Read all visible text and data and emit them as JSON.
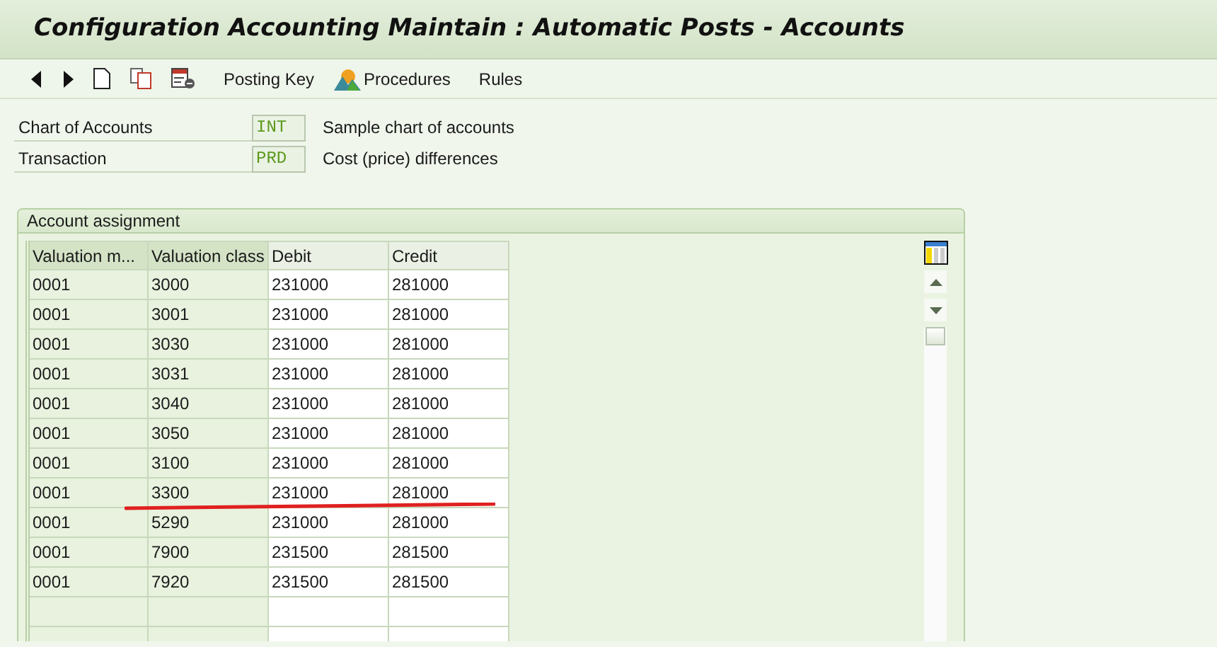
{
  "window": {
    "title": "Configuration Accounting Maintain : Automatic Posts - Accounts"
  },
  "toolbar": {
    "buttons": [
      {
        "kind": "back"
      },
      {
        "kind": "forward"
      },
      {
        "kind": "new"
      },
      {
        "kind": "copy"
      },
      {
        "kind": "delete"
      },
      {
        "kind": "text",
        "label": "Posting Key"
      },
      {
        "kind": "procedures",
        "label": "Procedures"
      },
      {
        "kind": "text",
        "label": "Rules"
      }
    ]
  },
  "fields": [
    {
      "label": "Chart of Accounts",
      "value": "INT",
      "description": "Sample chart of accounts"
    },
    {
      "label": "Transaction",
      "value": "PRD",
      "description": "Cost (price) differences"
    }
  ],
  "panel": {
    "title": "Account assignment",
    "table": {
      "columns": [
        {
          "label": "Valuation m...",
          "key_column": true
        },
        {
          "label": "Valuation class",
          "key_column": true
        },
        {
          "label": "Debit",
          "key_column": false
        },
        {
          "label": "Credit",
          "key_column": false
        }
      ],
      "rows": [
        {
          "cells": [
            "0001",
            "3000",
            "231000",
            "281000"
          ],
          "underlined": false
        },
        {
          "cells": [
            "0001",
            "3001",
            "231000",
            "281000"
          ],
          "underlined": false
        },
        {
          "cells": [
            "0001",
            "3030",
            "231000",
            "281000"
          ],
          "underlined": false
        },
        {
          "cells": [
            "0001",
            "3031",
            "231000",
            "281000"
          ],
          "underlined": false
        },
        {
          "cells": [
            "0001",
            "3040",
            "231000",
            "281000"
          ],
          "underlined": false
        },
        {
          "cells": [
            "0001",
            "3050",
            "231000",
            "281000"
          ],
          "underlined": false
        },
        {
          "cells": [
            "0001",
            "3100",
            "231000",
            "281000"
          ],
          "underlined": false
        },
        {
          "cells": [
            "0001",
            "3300",
            "231000",
            "281000"
          ],
          "underlined": true
        },
        {
          "cells": [
            "0001",
            "5290",
            "231000",
            "281000"
          ],
          "underlined": false
        },
        {
          "cells": [
            "0001",
            "7900",
            "231500",
            "281500"
          ],
          "underlined": false
        },
        {
          "cells": [
            "0001",
            "7920",
            "231500",
            "281500"
          ],
          "underlined": false
        }
      ]
    }
  }
}
